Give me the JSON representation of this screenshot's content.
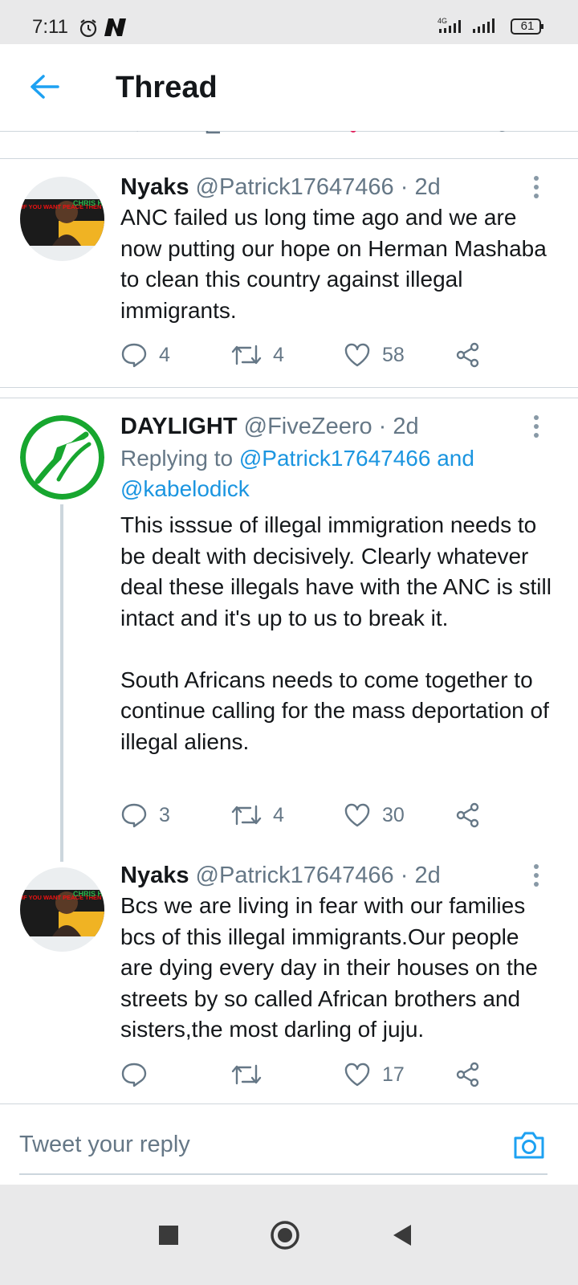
{
  "status_bar": {
    "time": "7:11",
    "network": "4G",
    "battery": "61"
  },
  "header": {
    "title": "Thread"
  },
  "tweets": [
    {
      "name": "Nyaks",
      "handle": "@Patrick17647466",
      "separator": "·",
      "ago": "2d",
      "text": "ANC failed us long time ago and we are now putting our hope on Herman Mashaba to clean this country against illegal immigrants.",
      "replies": "4",
      "retweets": "4",
      "likes": "58"
    },
    {
      "name": "DAYLIGHT",
      "handle": "@FiveZeero",
      "separator": "·",
      "ago": "2d",
      "replying_prefix": "Replying to ",
      "replying_to": "@Patrick17647466 and @kabelodick",
      "text": "This isssue of illegal immigration needs to be dealt with decisively. Clearly whatever deal these illegals have with the ANC is still intact and it's up to us to break it.\n\nSouth Africans needs to come together to continue calling for the mass deportation of illegal aliens.",
      "replies": "3",
      "retweets": "4",
      "likes": "30"
    },
    {
      "name": "Nyaks",
      "handle": "@Patrick17647466",
      "separator": "·",
      "ago": "2d",
      "text": "Bcs we are living in fear with our families bcs of this illegal immigrants.Our people are dying every day in their houses on the streets by so called African brothers and sisters,the most darling of juju.",
      "replies": "",
      "retweets": "",
      "likes": "17"
    }
  ],
  "avatar_art": {
    "left_text": "IF YOU WANT PEACE THEN YOU MUST STRUGGLE FOR SOCIAL JUSTICE",
    "right_text": "CHRIS HANI"
  },
  "reply_bar": {
    "placeholder": "Tweet your reply"
  },
  "colors": {
    "accent": "#1da1f2",
    "muted": "#657786",
    "daylight_green": "#17a62f"
  },
  "icons": [
    "back-arrow-icon",
    "reply-icon",
    "retweet-icon",
    "like-icon",
    "share-icon",
    "camera-icon",
    "more-icon"
  ]
}
